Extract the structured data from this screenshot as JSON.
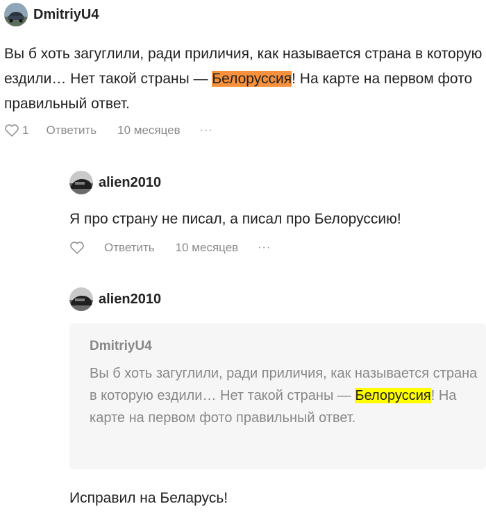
{
  "comments": [
    {
      "author": "DmitriyU4",
      "text_before": "Вы б хоть загуглили, ради приличия, как называется страна в которую ездили… Нет такой страны — ",
      "highlight": "Белоруссия",
      "text_after": "! На карте на первом фото правильный ответ.",
      "likes": "1",
      "reply_label": "Ответить",
      "time": "10 месяцев",
      "more": "···"
    },
    {
      "author": "alien2010",
      "text": "Я про страну не писал, а писал про Белоруссию!",
      "reply_label": "Ответить",
      "time": "10 месяцев",
      "more": "···"
    },
    {
      "author": "alien2010",
      "quote": {
        "author": "DmitriyU4",
        "text_before": "Вы б хоть загуглили, ради приличия, как называется страна в которую ездили… Нет такой страны — ",
        "highlight": "Белоруссия",
        "text_after": "! На карте на первом фото правильный ответ."
      },
      "text": "Исправил на Беларусь!"
    }
  ],
  "colors": {
    "highlight_orange": "#f7913d",
    "highlight_yellow": "#ffff00",
    "muted_text": "#8a8a8a",
    "quote_bg": "#f6f6f6"
  },
  "icons": {
    "like": "heart-outline-icon",
    "more": "more-dots-icon"
  }
}
